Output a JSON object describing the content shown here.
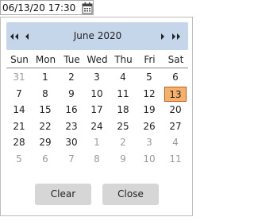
{
  "input": {
    "value": "06/13/20 17:30"
  },
  "icons": {
    "calendar": "calendar-icon"
  },
  "header": {
    "month_label": "June 2020"
  },
  "weekdays": [
    "Sun",
    "Mon",
    "Tue",
    "Wed",
    "Thu",
    "Fri",
    "Sat"
  ],
  "weeks": [
    [
      {
        "d": "31",
        "other": true
      },
      {
        "d": "1"
      },
      {
        "d": "2"
      },
      {
        "d": "3"
      },
      {
        "d": "4"
      },
      {
        "d": "5"
      },
      {
        "d": "6"
      }
    ],
    [
      {
        "d": "7"
      },
      {
        "d": "8"
      },
      {
        "d": "9"
      },
      {
        "d": "10"
      },
      {
        "d": "11"
      },
      {
        "d": "12"
      },
      {
        "d": "13",
        "selected": true
      }
    ],
    [
      {
        "d": "14"
      },
      {
        "d": "15"
      },
      {
        "d": "16"
      },
      {
        "d": "17"
      },
      {
        "d": "18"
      },
      {
        "d": "19"
      },
      {
        "d": "20"
      }
    ],
    [
      {
        "d": "21"
      },
      {
        "d": "22"
      },
      {
        "d": "23"
      },
      {
        "d": "24"
      },
      {
        "d": "25"
      },
      {
        "d": "26"
      },
      {
        "d": "27"
      }
    ],
    [
      {
        "d": "28"
      },
      {
        "d": "29"
      },
      {
        "d": "30"
      },
      {
        "d": "1",
        "other": true
      },
      {
        "d": "2",
        "other": true
      },
      {
        "d": "3",
        "other": true
      },
      {
        "d": "4",
        "other": true
      }
    ],
    [
      {
        "d": "5",
        "other": true
      },
      {
        "d": "6",
        "other": true
      },
      {
        "d": "7",
        "other": true
      },
      {
        "d": "8",
        "other": true
      },
      {
        "d": "9",
        "other": true
      },
      {
        "d": "10",
        "other": true
      },
      {
        "d": "11",
        "other": true
      }
    ]
  ],
  "buttons": {
    "clear": "Clear",
    "close": "Close"
  },
  "colors": {
    "header_bg": "#c5d5ea",
    "selected_bg": "#f5b06a",
    "selected_border": "#c45a1c",
    "other_month_text": "#9a9a9a",
    "button_bg": "#d6d6d6"
  }
}
